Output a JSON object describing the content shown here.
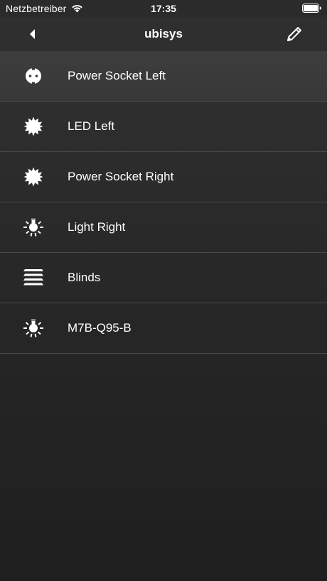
{
  "status_bar": {
    "carrier": "Netzbetreiber",
    "time": "17:35",
    "wifi_icon": "wifi-icon",
    "battery_icon": "battery-icon"
  },
  "nav": {
    "title": "ubisys",
    "back_icon": "back-arrow-icon",
    "edit_icon": "pencil-icon"
  },
  "devices": [
    {
      "label": "Power Socket Left",
      "icon": "power-socket-icon"
    },
    {
      "label": "LED Left",
      "icon": "starburst-icon"
    },
    {
      "label": "Power Socket Right",
      "icon": "starburst-icon"
    },
    {
      "label": "Light Right",
      "icon": "light-bulb-icon"
    },
    {
      "label": "Blinds",
      "icon": "blinds-icon"
    },
    {
      "label": "M7B-Q95-B",
      "icon": "light-bulb-icon"
    }
  ],
  "colors": {
    "background_top": "#3a3a3a",
    "background_bottom": "#1f1f1f",
    "separator": "#4a4a4a",
    "text": "#ffffff"
  }
}
